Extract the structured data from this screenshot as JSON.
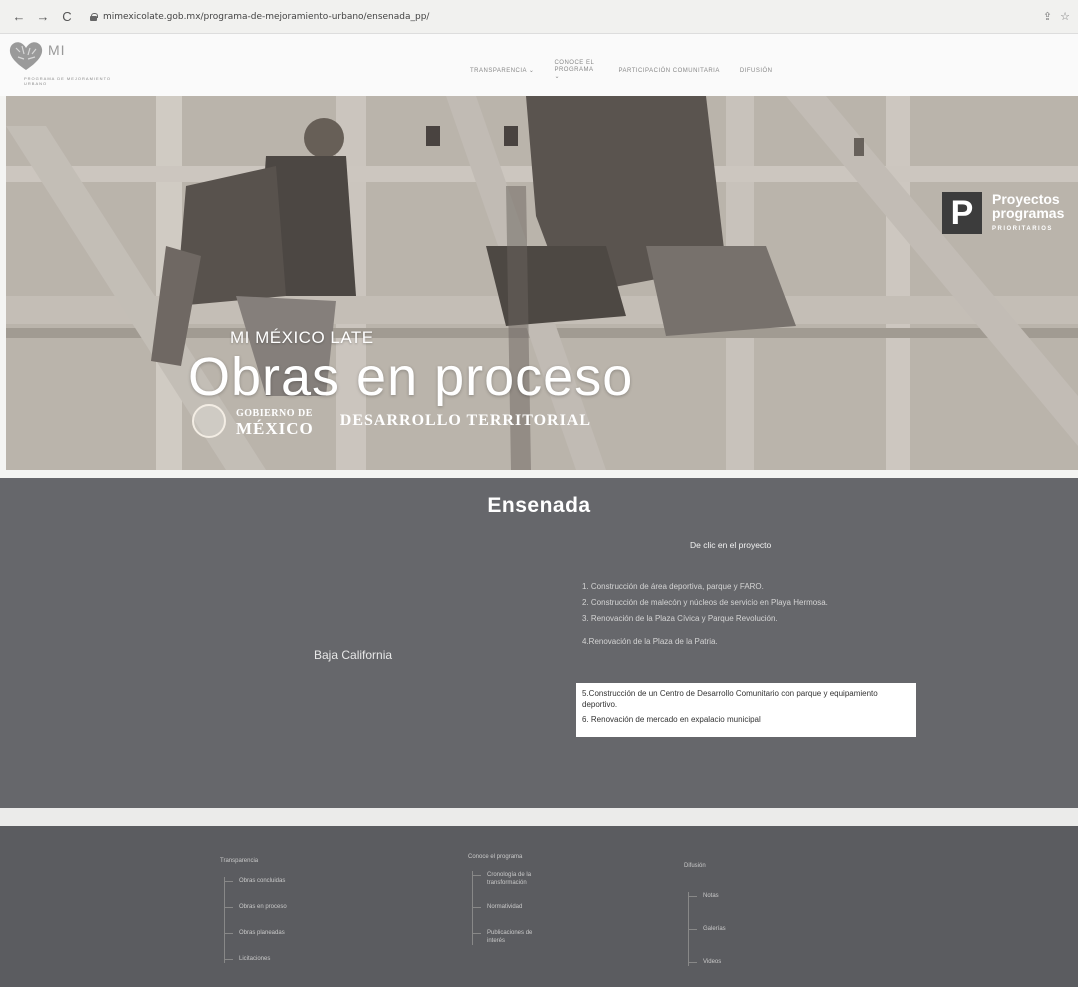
{
  "browser": {
    "url": "mimexicolate.gob.mx/programa-de-mejoramiento-urbano/ensenada_pp/",
    "back_icon": "←",
    "forward_icon": "→",
    "reload_icon": "C",
    "share_icon": "⇪",
    "profile_icon": "☆"
  },
  "site": {
    "logo_mi": "MI",
    "logo_sub": "PROGRAMA DE MEJORAMIENTO URBANO",
    "nav": [
      {
        "label": "TRANSPARENCIA ⌄"
      },
      {
        "label": "CONOCE EL PROGRAMA ⌄"
      },
      {
        "label": "PARTICIPACIÓN COMUNITARIA"
      },
      {
        "label": "DIFUSIÓN"
      }
    ]
  },
  "hero": {
    "eyebrow": "MI MÉXICO LATE",
    "title": "Obras en proceso",
    "gov_line1": "GOBIERNO DE",
    "gov_line2": "MÉXICO",
    "dept": "DESARROLLO TERRITORIAL",
    "badge_letter": "P",
    "badge_line1": "Proyectos",
    "badge_line2": "programas",
    "badge_line3": "PRIORITARIOS"
  },
  "ensenada": {
    "title": "Ensenada",
    "state": "Baja California",
    "hint": "De clic en el proyecto",
    "projects": [
      "1. Construcción de área deportiva, parque y FARO.",
      "2. Construcción de malecón y núcleos de servicio en Playa Hermosa.",
      "3. Renovación de la Plaza Cívica y Parque Revolución.",
      "4.Renovación de la Plaza de la Patria."
    ],
    "highlight_1": "5.Construcción de un Centro de Desarrollo Comunitario con parque y equipamiento deportivo.",
    "highlight_2": "6. Renovación de mercado en expalacio municipal"
  },
  "footer": {
    "col1": {
      "heading": "Transparencia",
      "links": [
        "Obras concluidas",
        "Obras en proceso",
        "Obras planeadas",
        "Licitaciones"
      ]
    },
    "col2": {
      "heading": "Conoce el programa",
      "links": [
        "Cronología de la transformación",
        "Normatividad",
        "Publicaciones de interés"
      ]
    },
    "col3": {
      "heading": "Difusión",
      "links": [
        "Notas",
        "Galerías",
        "Videos"
      ]
    }
  }
}
